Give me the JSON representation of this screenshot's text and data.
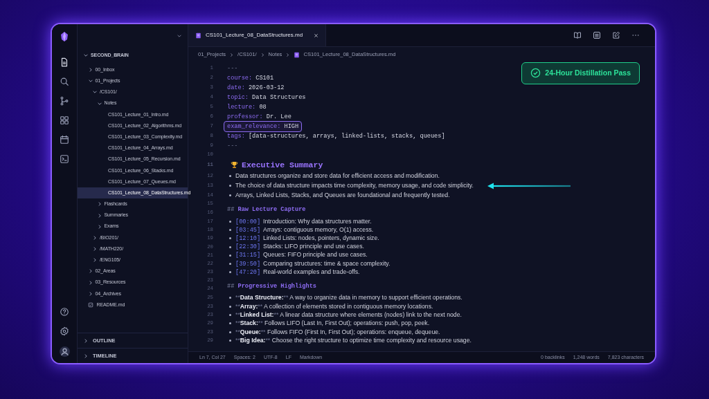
{
  "sidebar": {
    "tree": [
      {
        "label": "SECOND_BRAIN",
        "kind": "vault",
        "expanded": true,
        "selected": false,
        "children": [
          {
            "label": "00_Inbox",
            "kind": "folder",
            "expanded": false,
            "selected": false
          },
          {
            "label": "01_Projects",
            "kind": "folder",
            "expanded": true,
            "selected": false,
            "children": [
              {
                "label": "/CS101/",
                "kind": "folder",
                "expanded": true,
                "selected": false,
                "children": [
                  {
                    "label": "Notes",
                    "kind": "folder",
                    "expanded": true,
                    "selected": false,
                    "children": [
                      {
                        "label": "CS101_Lecture_01_Intro.md",
                        "kind": "file",
                        "selected": false
                      },
                      {
                        "label": "CS101_Lecture_02_Algorithms.md",
                        "kind": "file",
                        "selected": false
                      },
                      {
                        "label": "CS101_Lecture_03_Complexity.md",
                        "kind": "file",
                        "selected": false
                      },
                      {
                        "label": "CS101_Lecture_04_Arrays.md",
                        "kind": "file",
                        "selected": false
                      },
                      {
                        "label": "CS101_Lecture_05_Recursion.md",
                        "kind": "file",
                        "selected": false
                      },
                      {
                        "label": "CS101_Lecture_06_Stacks.md",
                        "kind": "file",
                        "selected": false
                      },
                      {
                        "label": "CS101_Lecture_07_Queues.md",
                        "kind": "file",
                        "selected": false
                      },
                      {
                        "label": "CS101_Lecture_08_DataStructures.md",
                        "kind": "file",
                        "selected": true
                      }
                    ]
                  },
                  {
                    "label": "Flashcards",
                    "kind": "folder",
                    "expanded": false,
                    "selected": false
                  },
                  {
                    "label": "Summaries",
                    "kind": "folder",
                    "expanded": false,
                    "selected": false
                  },
                  {
                    "label": "Exams",
                    "kind": "folder",
                    "expanded": false,
                    "selected": false
                  }
                ]
              },
              {
                "label": "/BIO201/",
                "kind": "folder",
                "expanded": false,
                "selected": false
              },
              {
                "label": "/MATH220/",
                "kind": "folder",
                "expanded": false,
                "selected": false
              },
              {
                "label": "/ENG105/",
                "kind": "folder",
                "expanded": false,
                "selected": false
              }
            ]
          },
          {
            "label": "02_Areas",
            "kind": "folder",
            "expanded": false,
            "selected": false
          },
          {
            "label": "03_Resources",
            "kind": "folder",
            "expanded": false,
            "selected": false
          },
          {
            "label": "04_Archives",
            "kind": "folder",
            "expanded": false,
            "selected": false
          },
          {
            "label": "README.md",
            "kind": "doc",
            "selected": false
          }
        ]
      }
    ],
    "panels": [
      {
        "label": "OUTLINE",
        "expanded": false
      },
      {
        "label": "TIMELINE",
        "expanded": false
      }
    ]
  },
  "tabs": [
    {
      "label": "CS101_Lecture_08_DataStructures.md",
      "selected": true
    }
  ],
  "breadcrumb": [
    "01_Projects",
    "/CS101/",
    "Notes",
    "CS101_Lecture_08_DataStructures.md"
  ],
  "badge": "24-Hour Distillation Pass",
  "lines": [
    {
      "number": "1",
      "kind": "delimiter",
      "text": "---"
    },
    {
      "number": "2",
      "kind": "property",
      "key": "course:",
      "value": "CS101",
      "highlighted": false
    },
    {
      "number": "3",
      "kind": "property",
      "key": "date:",
      "value": "2026-03-12",
      "highlighted": false
    },
    {
      "number": "4",
      "kind": "property",
      "key": "topic:",
      "value": "Data Structures",
      "highlighted": false
    },
    {
      "number": "5",
      "kind": "property",
      "key": "lecture:",
      "value": "08",
      "highlighted": false
    },
    {
      "number": "6",
      "kind": "property",
      "key": "professor:",
      "value": "Dr. Lee",
      "highlighted": false
    },
    {
      "number": "7",
      "kind": "property",
      "key": "exam_relevance:",
      "value": "HIGH",
      "highlighted": true
    },
    {
      "number": "8",
      "kind": "property",
      "key": "tags:",
      "value": "[data-structures, arrays, linked-lists, stacks, queues]",
      "highlighted": false
    },
    {
      "number": "9",
      "kind": "delimiter",
      "text": "---"
    },
    {
      "number": "10",
      "kind": "blank"
    },
    {
      "number": "11",
      "kind": "title",
      "text": "Executive Summary"
    },
    {
      "number": "12",
      "kind": "bullet",
      "text": "Data structures organize and store data for efficient access and modification.",
      "pointer": false
    },
    {
      "number": "13",
      "kind": "bullet",
      "text": "The choice of data structure impacts time complexity, memory usage, and code simplicity.",
      "pointer": true
    },
    {
      "number": "14",
      "kind": "bullet",
      "text": "Arrays, Linked Lists, Stacks, and Queues are foundational and frequently tested.",
      "pointer": false
    },
    {
      "number": "15",
      "kind": "blank"
    },
    {
      "number": "16",
      "kind": "heading",
      "marker": "##",
      "text": "Raw Lecture Capture"
    },
    {
      "number": "17",
      "kind": "timestamp",
      "stamp": "[00:00]",
      "text": "Introduction: Why data structures matter."
    },
    {
      "number": "18",
      "kind": "timestamp",
      "stamp": "[03:45]",
      "text": "Arrays: contiguous memory, O(1) access."
    },
    {
      "number": "19",
      "kind": "timestamp",
      "stamp": "[12:10]",
      "text": "Linked Lists: nodes, pointers, dynamic size."
    },
    {
      "number": "20",
      "kind": "timestamp",
      "stamp": "[22:30]",
      "text": "Stacks: LIFO principle and use cases."
    },
    {
      "number": "21",
      "kind": "timestamp",
      "stamp": "[31:15]",
      "text": "Queues: FIFO principle and use cases."
    },
    {
      "number": "22",
      "kind": "timestamp",
      "stamp": "[39:50]",
      "text": "Comparing structures: time & space complexity."
    },
    {
      "number": "23",
      "kind": "timestamp",
      "stamp": "[47:20]",
      "text": "Real-world examples and trade-offs."
    },
    {
      "number": "23",
      "kind": "blank"
    },
    {
      "number": "24",
      "kind": "heading",
      "marker": "##",
      "text": "Progressive Highlights"
    },
    {
      "number": "25",
      "kind": "term",
      "open_mark": "**",
      "term": "Data Structure:",
      "close_mark": "**",
      "text": "A way to organize data in memory to support efficient operations."
    },
    {
      "number": "23",
      "kind": "term",
      "open_mark": "**",
      "term": "Array:",
      "close_mark": "**",
      "text": "A collection of elements stored in contiguous memory locations."
    },
    {
      "number": "23",
      "kind": "term",
      "open_mark": "**",
      "term": "Linked List:",
      "close_mark": "**",
      "text": "A linear data structure where elements (nodes) link to the next node."
    },
    {
      "number": "29",
      "kind": "term",
      "open_mark": "**",
      "term": "Stack:",
      "close_mark": "**",
      "text": "Follows LIFO (Last In, First Out); operations: push, pop, peek."
    },
    {
      "number": "23",
      "kind": "term",
      "open_mark": "**",
      "term": "Queue:",
      "close_mark": "**",
      "text": "Follows FIFO (First In, First Out); operations: enqueue, dequeue."
    },
    {
      "number": "29",
      "kind": "term",
      "open_mark": "**",
      "term": "Big Idea:",
      "close_mark": "**",
      "text": "Choose the right structure to optimize time complexity and resource usage."
    }
  ],
  "status_bar": {
    "left": [
      "Ln 7, Col 27",
      "Spaces: 2",
      "UTF-8",
      "LF",
      "Markdown"
    ],
    "right": [
      "0 backlinks",
      "1,248 words",
      "7,823 characters"
    ]
  }
}
